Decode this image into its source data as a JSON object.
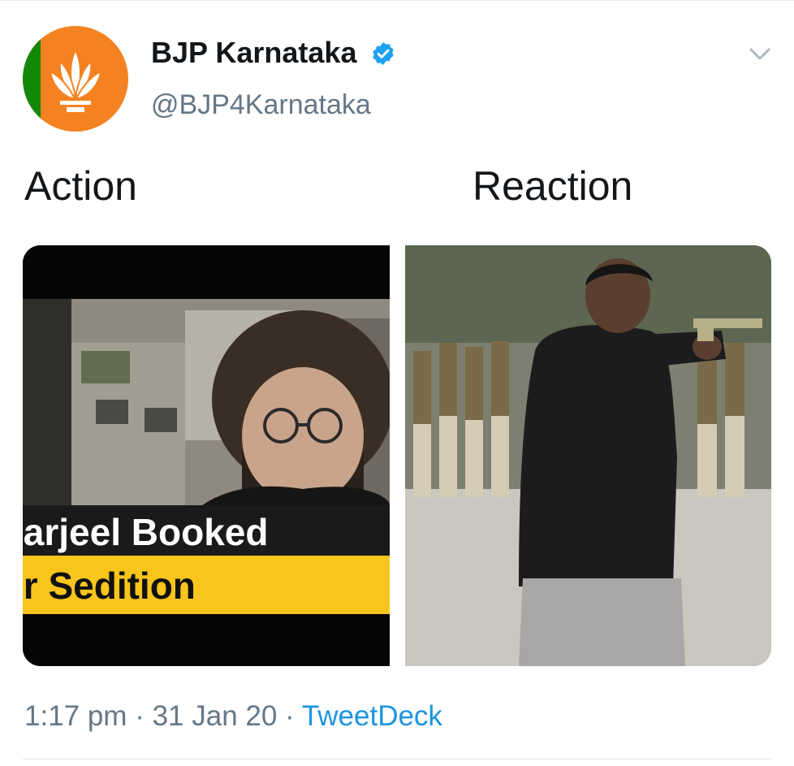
{
  "tweet": {
    "author_name": "BJP Karnataka",
    "author_handle": "@BJP4Karnataka",
    "verified": true,
    "timestamp": "1:17 pm",
    "separator": " · ",
    "date": "31 Jan 20",
    "source": "TweetDeck",
    "media": [
      {
        "caption": "Action",
        "banner_line1": "ıarjeel Booked",
        "banner_line2": "ır Sedition"
      },
      {
        "caption": "Reaction"
      }
    ]
  },
  "icons": {
    "avatar": "bjp-lotus-logo-icon",
    "verified": "verified-badge-icon",
    "menu": "chevron-down-icon"
  },
  "colors": {
    "link": "#1b95e0",
    "secondary_text": "#657786",
    "verified": "#1da1f2",
    "banner_yellow": "#f8c51c",
    "logo_saffron": "#f58220"
  }
}
